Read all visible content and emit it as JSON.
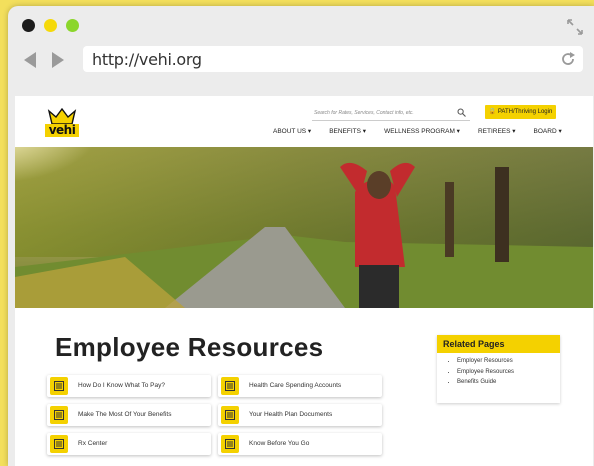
{
  "browser": {
    "url": "http://vehi.org"
  },
  "site": {
    "logo_text": "vehi",
    "search_placeholder": "Search for Rates, Services, Contact info, etc.",
    "login_label": "PATH/Thriving Login",
    "menu": [
      "ABOUT US",
      "BENEFITS",
      "WELLNESS PROGRAM",
      "RETIREES",
      "BOARD"
    ]
  },
  "main": {
    "title": "Employee Resources",
    "cards": [
      "How Do I Know What To Pay?",
      "Health Care Spending Accounts",
      "Make The Most Of Your Benefits",
      "Your Health Plan Documents",
      "Rx Center",
      "Know Before You Go"
    ]
  },
  "related": {
    "title": "Related Pages",
    "items": [
      "Employer Resources",
      "Employee Resources",
      "Benefits Guide"
    ]
  },
  "colors": {
    "brand_yellow": "#f4d100",
    "background_yellow": "#f3df5c"
  }
}
